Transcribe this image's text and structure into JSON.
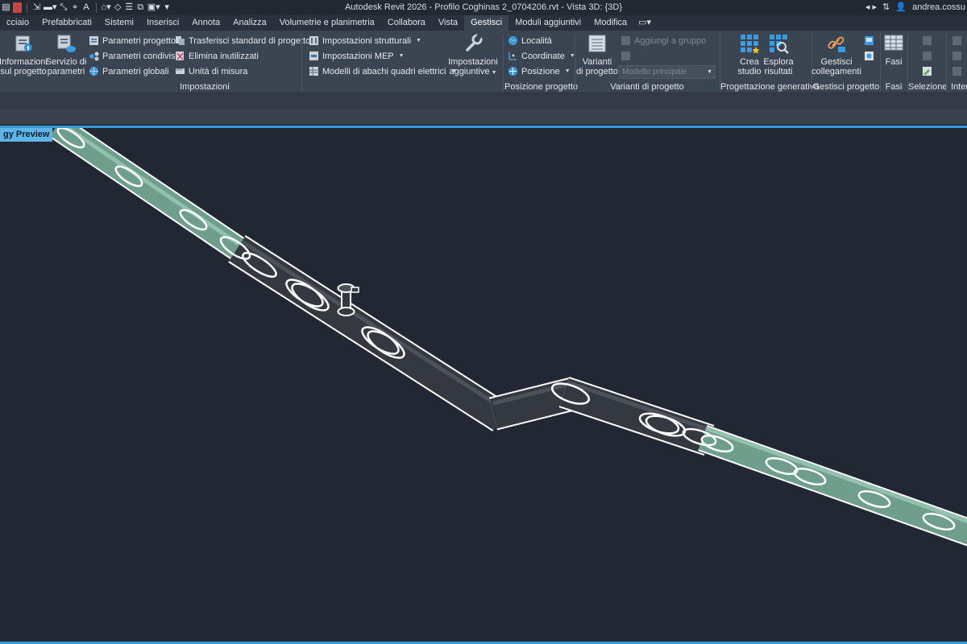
{
  "app_title": "Autodesk Revit 2026 - Profilo Coghinas 2_0704206.rvt - Vista 3D: {3D}",
  "user": "andrea.cossu",
  "quick_access": {
    "text_icon": "A"
  },
  "tabs": [
    {
      "label": "cciaio"
    },
    {
      "label": "Prefabbricati"
    },
    {
      "label": "Sistemi"
    },
    {
      "label": "Inserisci"
    },
    {
      "label": "Annota"
    },
    {
      "label": "Analizza"
    },
    {
      "label": "Volumetrie e planimetria"
    },
    {
      "label": "Collabora"
    },
    {
      "label": "Vista"
    },
    {
      "label": "Gestisci",
      "active": true
    },
    {
      "label": "Moduli aggiuntivi"
    },
    {
      "label": "Modifica"
    }
  ],
  "ribbon": {
    "impostazioni": {
      "label": "Impostazioni",
      "info_line1": "Informazioni",
      "info_line2": "sul progetto",
      "servizio_line1": "Servizio di",
      "servizio_line2": "parametri",
      "parametri_progetto": "Parametri progetto",
      "parametri_condivisi": "Parametri condivisi",
      "parametri_globali": "Parametri  globali",
      "trasferisci": "Trasferisci standard di progetto",
      "elimina": "Elimina inutilizzati",
      "unita": "Unità di misura",
      "imp_strutturali": "Impostazioni strutturali",
      "imp_mep": "Impostazioni MEP",
      "modelli_abachi": "Modelli di abachi quadri elettrici",
      "imp_agg_line1": "Impostazioni",
      "imp_agg_line2": "aggiuntive"
    },
    "posizione": {
      "label": "Posizione progetto",
      "localita": "Località",
      "coordinate": "Coordinate",
      "posizione": "Posizione"
    },
    "varianti": {
      "label": "Varianti di progetto",
      "btn_line1": "Varianti",
      "btn_line2": "di progetto",
      "aggiungi": "Aggiungi a gruppo",
      "modello": "Modello principale"
    },
    "generativa": {
      "label": "Progettazione generativa",
      "crea_line1": "Crea",
      "crea_line2": "studio",
      "esplora_line1": "Esplora",
      "esplora_line2": "risultati"
    },
    "gestisci_progetto": {
      "label": "Gestisci progetto",
      "btn_line1": "Gestisci",
      "btn_line2": "collegamenti"
    },
    "fasi": {
      "label": "Fasi",
      "btn": "Fasi"
    },
    "selezione": {
      "label": "Selezione"
    },
    "inter": {
      "label": "Inter"
    }
  },
  "viewport": {
    "tag": "gy Preview"
  },
  "colors": {
    "accent": "#3a9ad9",
    "pipe_green": "#6f9f8c",
    "pipe_dark": "#353a40",
    "canvas": "#212733"
  }
}
